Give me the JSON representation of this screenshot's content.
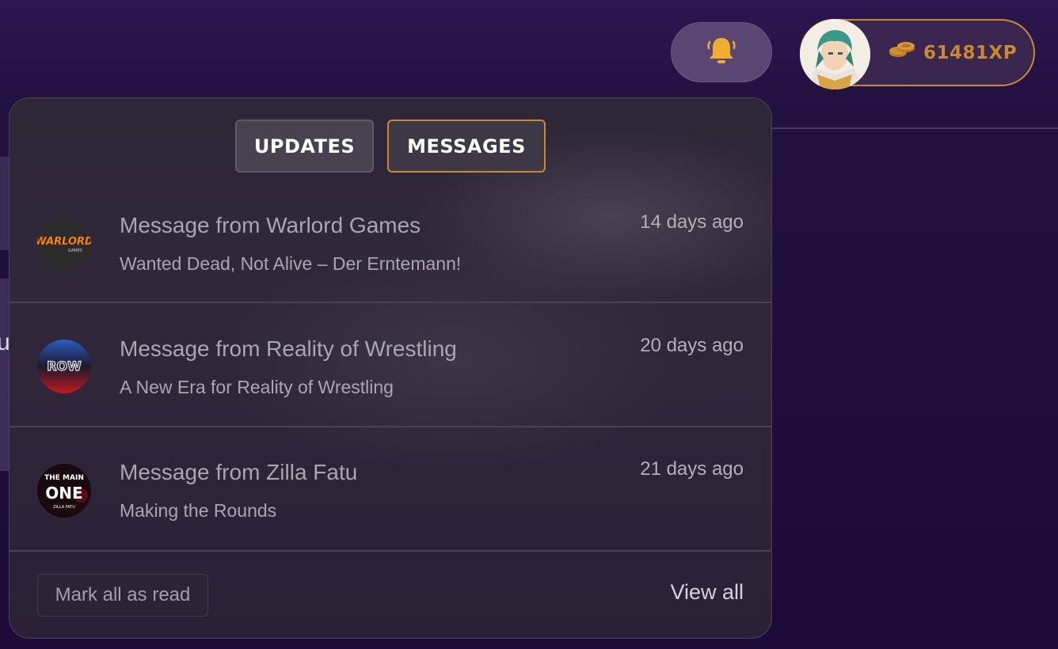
{
  "header": {
    "bell_icon": "bell-icon",
    "xp_value": "61481XP",
    "coins_icon": "coins-icon",
    "accent_color": "#c88a2e"
  },
  "panel": {
    "tabs": [
      {
        "label": "UPDATES",
        "active": false
      },
      {
        "label": "MESSAGES",
        "active": true
      }
    ],
    "messages": [
      {
        "title": "Message from Warlord Games",
        "subtitle": "Wanted Dead, Not Alive – Der Erntemann!",
        "time": "14 days ago",
        "logo": "WARLORD"
      },
      {
        "title": "Message from Reality of Wrestling",
        "subtitle": "A New Era for Reality of Wrestling",
        "time": "20 days ago",
        "logo": "ROW"
      },
      {
        "title": "Message from Zilla Fatu",
        "subtitle": "Making the Rounds",
        "time": "21 days ago",
        "logo": "THE MAIN ONE"
      }
    ],
    "footer": {
      "mark_all": "Mark all as read",
      "view_all": "View all"
    }
  }
}
